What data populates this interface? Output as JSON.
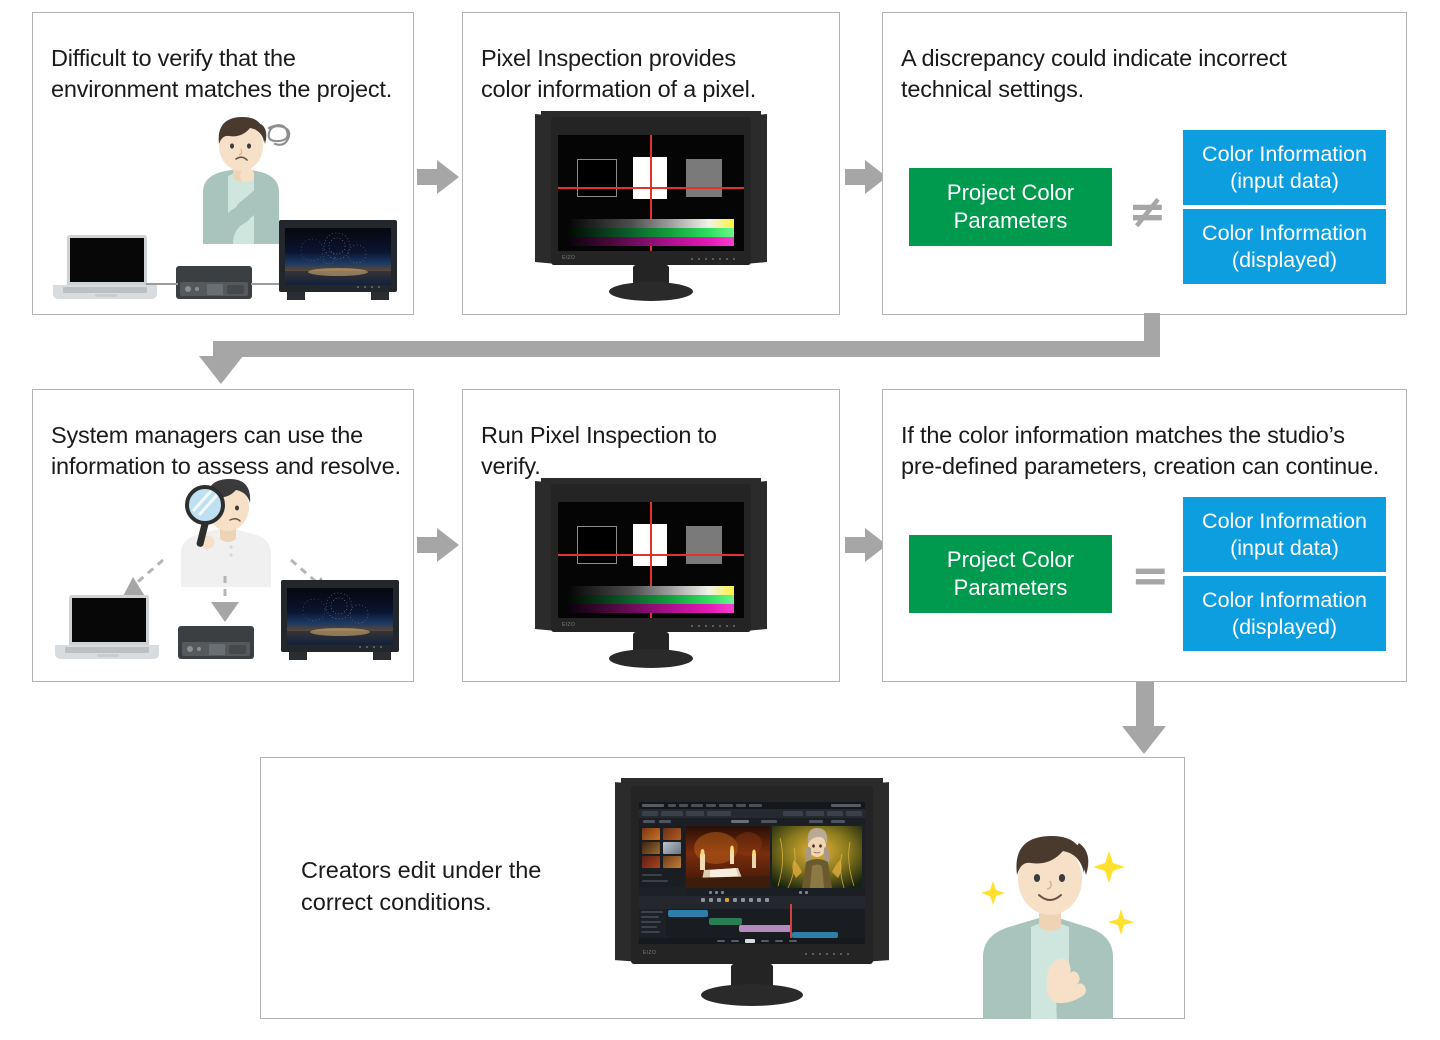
{
  "diagram": {
    "title_text_color": "#1a1a1a",
    "panel_border_color": "#b3b3b3",
    "arrow_color": "#a6a6a6",
    "accent_green": "#009a4e",
    "accent_blue": "#0d9ee0"
  },
  "panels": [
    {
      "id": "panel-problem",
      "caption": "Difficult to verify that the\nenvironment matches the project.",
      "illustration": "worried-person-with-laptop-deck-and-reference-monitor"
    },
    {
      "id": "panel-pixel-inspection",
      "caption": "Pixel Inspection provides\ncolor information of a pixel.",
      "illustration": "eizo-monitor-showing-pixel-inspection-crosshair"
    },
    {
      "id": "panel-discrepancy",
      "caption": "A discrepancy could indicate incorrect\ntechnical settings.",
      "comparison": {
        "left_label": "Project Color\nParameters",
        "operator": "≠",
        "operator_name": "not-equal-sign",
        "right_labels": [
          "Color Information\n(input data)",
          "Color Information\n(displayed)"
        ]
      }
    },
    {
      "id": "panel-system-managers",
      "caption": "System managers can use the\ninformation to assess and resolve.",
      "illustration": "manager-with-magnifying-glass-pointing-to-three-devices"
    },
    {
      "id": "panel-run-inspection",
      "caption": "Run Pixel Inspection to\nverify.",
      "illustration": "eizo-monitor-showing-pixel-inspection-crosshair"
    },
    {
      "id": "panel-match",
      "caption": "If the color information matches the studio’s\npre-defined parameters, creation can continue.",
      "comparison": {
        "left_label": "Project Color\nParameters",
        "operator": "=",
        "operator_name": "equals-sign",
        "right_labels": [
          "Color Information\n(input data)",
          "Color Information\n(displayed)"
        ]
      }
    },
    {
      "id": "panel-result",
      "caption": "Creators edit under the\ncorrect conditions.",
      "illustration": "eizo-monitor-with-video-editing-timeline-and-happy-creator"
    }
  ],
  "monitor_screen": {
    "description": "pixel inspection test pattern",
    "squares": [
      {
        "name": "black-outlined-square",
        "fill": "#000000",
        "border": "#8c8c8c"
      },
      {
        "name": "white-square",
        "fill": "#ffffff"
      },
      {
        "name": "gray-square",
        "fill": "#7a7a7a"
      }
    ],
    "crosshair_color": "#e2322e",
    "gradient_bands": [
      "gray-to-yellow",
      "black-to-green",
      "black-to-magenta"
    ],
    "brand": "EIZO"
  },
  "flow_arrows": [
    {
      "name": "arrow-panel1-to-panel2",
      "direction": "right"
    },
    {
      "name": "arrow-panel2-to-panel3",
      "direction": "right"
    },
    {
      "name": "arrow-panel3-to-panel4",
      "direction": "down-left-wrap"
    },
    {
      "name": "arrow-panel4-to-panel5",
      "direction": "right"
    },
    {
      "name": "arrow-panel5-to-panel6",
      "direction": "right"
    },
    {
      "name": "arrow-panel6-to-result",
      "direction": "down"
    }
  ]
}
